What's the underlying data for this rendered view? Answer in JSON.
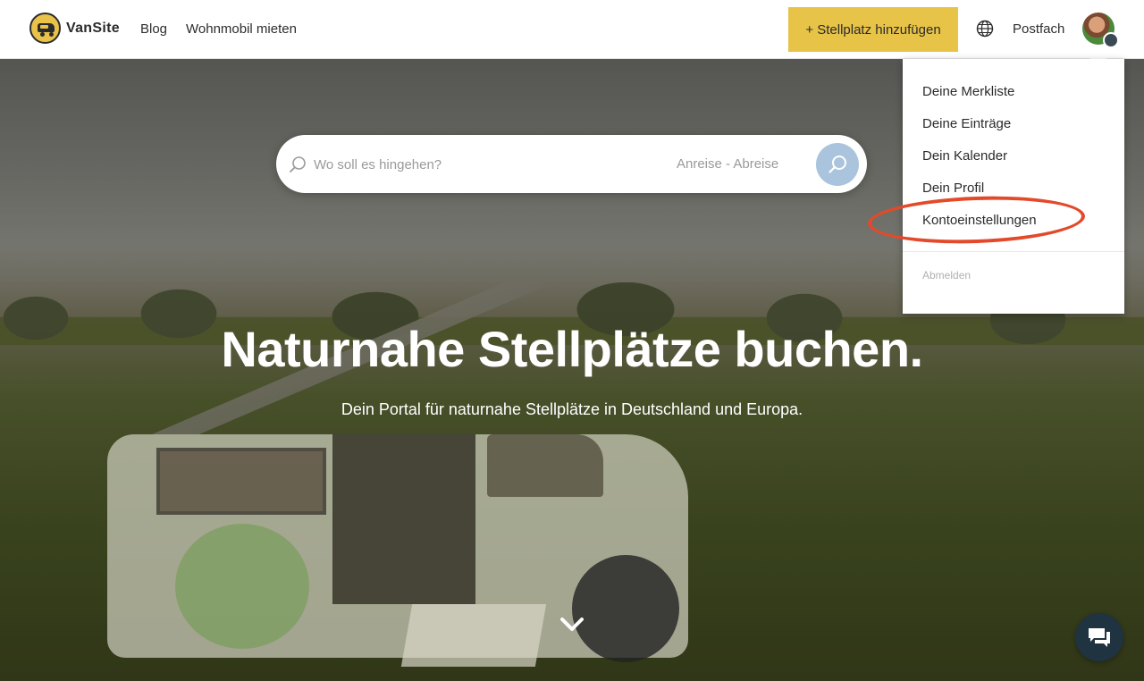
{
  "header": {
    "brand": "VanSite",
    "nav": {
      "blog": "Blog",
      "rent": "Wohnmobil mieten"
    },
    "add_button": "+ Stellplatz hinzufügen",
    "language_icon": "globe-icon",
    "inbox": "Postfach"
  },
  "search": {
    "placeholder": "Wo soll es hingehen?",
    "dates": "Anreise - Abreise"
  },
  "hero": {
    "title": "Naturnahe Stellplätze buchen.",
    "subtitle": "Dein Portal für naturnahe Stellplätze in Deutschland und Europa."
  },
  "account_menu": {
    "items": [
      {
        "label": "Deine Merkliste"
      },
      {
        "label": "Deine Einträge"
      },
      {
        "label": "Dein Kalender"
      },
      {
        "label": "Dein Profil"
      },
      {
        "label": "Kontoeinstellungen"
      }
    ],
    "logout": "Abmelden"
  },
  "colors": {
    "accent_yellow": "#e7c347",
    "search_button": "#a9c4dc",
    "highlight_ring": "#e24a2a",
    "chat_button": "#1f3340"
  }
}
